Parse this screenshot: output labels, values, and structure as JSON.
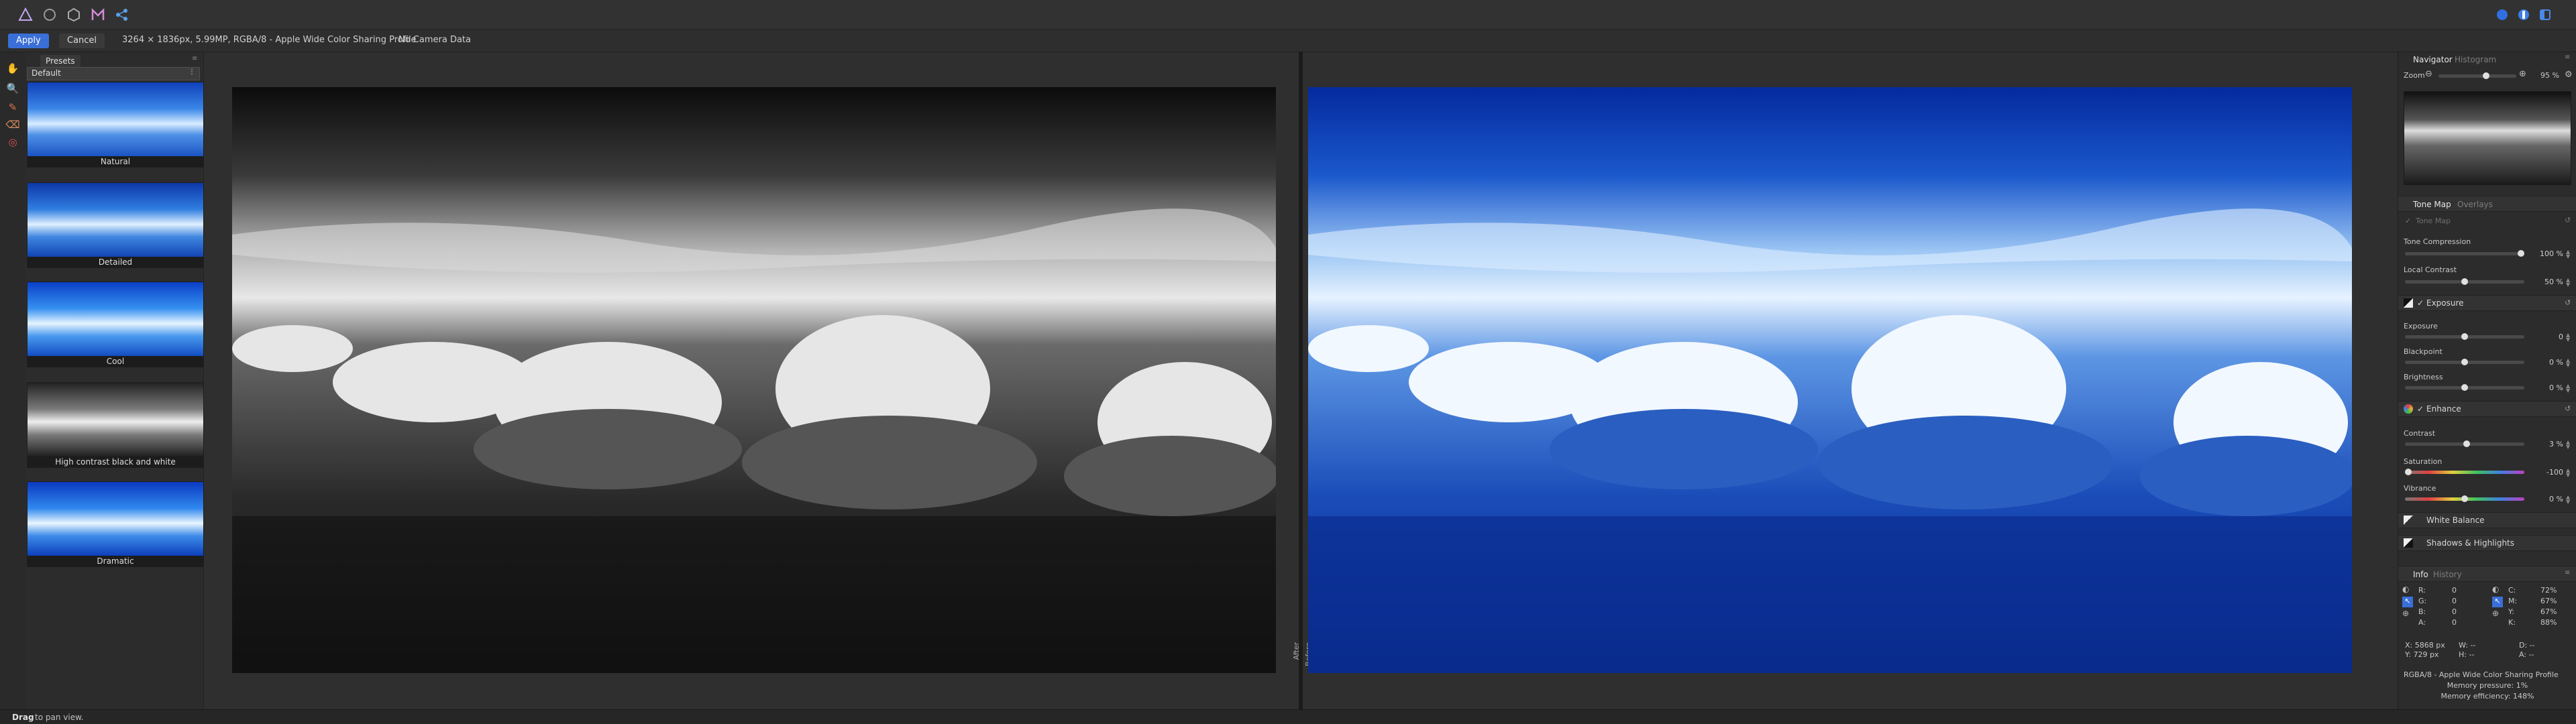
{
  "context_bar": {
    "apply": "Apply",
    "cancel": "Cancel",
    "image_info": "3264 × 1836px, 5.99MP, RGBA/8 - Apple Wide Color Sharing Profile",
    "camera_info": "No Camera Data"
  },
  "presets": {
    "tab": "Presets",
    "dropdown": "Default",
    "items": [
      {
        "label": "Natural"
      },
      {
        "label": "Detailed"
      },
      {
        "label": "Cool"
      },
      {
        "label": "High contrast black and white"
      },
      {
        "label": "Dramatic"
      }
    ]
  },
  "canvas": {
    "before_label": "After",
    "after_label": "Before"
  },
  "navigator": {
    "tab_active": "Navigator",
    "tab_inactive": "Histogram",
    "zoom_label": "Zoom",
    "zoom_value": "95 %",
    "zoom_fraction": 0.62
  },
  "tone_map": {
    "tab_active": "Tone Map",
    "tab_inactive": "Overlays",
    "tone_map_row": "Tone Map",
    "tone_compression": {
      "label": "Tone Compression",
      "value": "100 %",
      "fraction": 1.0
    },
    "local_contrast": {
      "label": "Local Contrast",
      "value": "50 %",
      "fraction": 0.5
    },
    "exposure_section": "Exposure",
    "exposure": {
      "label": "Exposure",
      "value": "0",
      "fraction": 0.5
    },
    "blackpoint": {
      "label": "Blackpoint",
      "value": "0 %",
      "fraction": 0.5
    },
    "brightness": {
      "label": "Brightness",
      "value": "0 %",
      "fraction": 0.5
    },
    "enhance_section": "Enhance",
    "contrast": {
      "label": "Contrast",
      "value": "3 %",
      "fraction": 0.52
    },
    "saturation": {
      "label": "Saturation",
      "value": "-100",
      "fraction": 0.0
    },
    "vibrance": {
      "label": "Vibrance",
      "value": "0 %",
      "fraction": 0.5
    },
    "white_balance": "White Balance",
    "shadows_highlights": "Shadows & Highlights"
  },
  "info": {
    "tab_active": "Info",
    "tab_inactive": "History",
    "left": {
      "R": "0",
      "G": "0",
      "B": "0",
      "A": "0"
    },
    "right": {
      "C": "72%",
      "M": "67%",
      "Y": "67%",
      "K": "88%"
    },
    "xy": {
      "x": "X: 5868 px",
      "y": "Y: 729 px",
      "w": "W: --",
      "h": "H: --",
      "d": "D: --",
      "a": "A: --"
    },
    "profile": "RGBA/8 - Apple Wide Color Sharing Profile",
    "memory_pressure": "Memory pressure: 1%",
    "memory_efficiency": "Memory efficiency: 148%"
  },
  "status": {
    "bold": "Drag",
    "text": " to pan view."
  },
  "colors": {
    "accent": "#3a6fd8"
  }
}
